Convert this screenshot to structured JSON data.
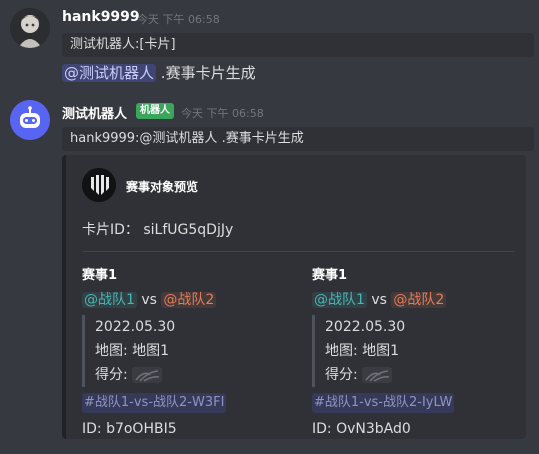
{
  "messages": [
    {
      "author": "hank9999",
      "timestamp": "今天 下午 06:58",
      "reply_preview": "测试机器人:[卡片]",
      "mention": "@测试机器人",
      "text": ".赛事卡片生成"
    },
    {
      "author": "测试机器人",
      "badge": "机器人",
      "timestamp": "今天 下午 06:58",
      "reply_preview": "hank9999:@测试机器人 .赛事卡片生成",
      "embed": {
        "title": "赛事对象预览",
        "card_id_label": "卡片ID：",
        "card_id": "siLfUG5qDjJy",
        "matches": [
          {
            "title": "赛事1",
            "team1": "@战队1",
            "vs": "vs",
            "team2": "@战队2",
            "date": "2022.05.30",
            "map": "地图: 地图1",
            "score_label": "得分:",
            "channel": "#战队1-vs-战队2-W3FI",
            "id": "ID: b7oOHBI5"
          },
          {
            "title": "赛事1",
            "team1": "@战队1",
            "vs": "vs",
            "team2": "@战队2",
            "date": "2022.05.30",
            "map": "地图: 地图1",
            "score_label": "得分:",
            "channel": "#战队1-vs-战队2-IyLW",
            "id": "ID: OvN3bAd0"
          }
        ]
      }
    }
  ],
  "colors": {
    "background": "#36393f",
    "embed_bg": "#2f3136",
    "bot_badge": "#3ba55c",
    "team1": "#49b6b6",
    "team2": "#e57c5a",
    "mention": "#c9cdfb"
  },
  "icons": {
    "avatar_user": "anime-avatar",
    "avatar_bot": "robot-icon",
    "embed_thumb": "logo-icon",
    "score": "scratch-icon"
  }
}
